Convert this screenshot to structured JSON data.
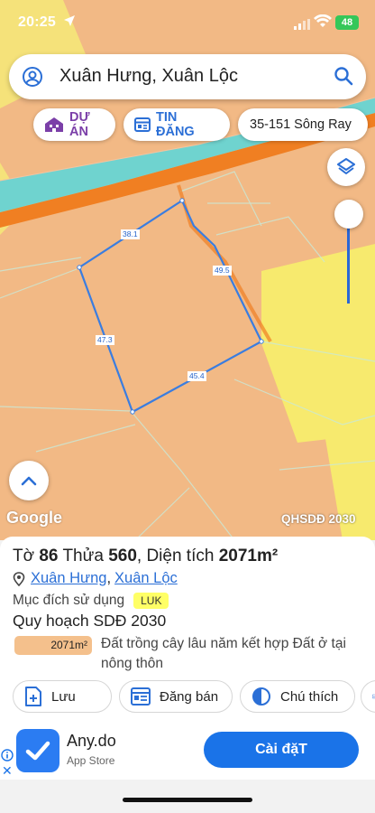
{
  "status_bar": {
    "time": "20:25",
    "battery": "48"
  },
  "search": {
    "title": "Xuân Hưng, Xuân Lộc"
  },
  "chips": {
    "du_an": "DỰ ÁN",
    "tin_dang": "TIN ĐĂNG",
    "location": "35-151 Sông Ray"
  },
  "map": {
    "google_label": "Google",
    "overlay_label": "QHSDĐ 2030",
    "dimensions": [
      "38.1",
      "49.5",
      "47.3",
      "45.4"
    ]
  },
  "parcel": {
    "headline_prefix": "Tờ",
    "sheet_no": "86",
    "lot_label": "Thửa",
    "lot_no": "560",
    "area_label": "Diện tích",
    "area": "2071m²",
    "commune": "Xuân Hưng",
    "district": "Xuân Lộc",
    "purpose_label": "Mục đích sử dụng",
    "purpose_code": "LUK",
    "plan_title": "Quy hoạch SDĐ 2030",
    "plan_area": "2071m²",
    "plan_description": "Đất trồng cây lâu năm kết hợp Đất ở tại nông thôn"
  },
  "actions": {
    "save": "Lưu",
    "post": "Đăng bán",
    "note": "Chú thích"
  },
  "ad": {
    "app_name": "Any.do",
    "store": "App Store",
    "install": "Cài đặT"
  },
  "colors": {
    "accent": "#1a73e8",
    "parcel_line": "#3a7de0",
    "land_orange": "#f2b985",
    "land_yellow": "#f7ea6e",
    "river": "#6fd3cf",
    "road": "#f07f22"
  }
}
